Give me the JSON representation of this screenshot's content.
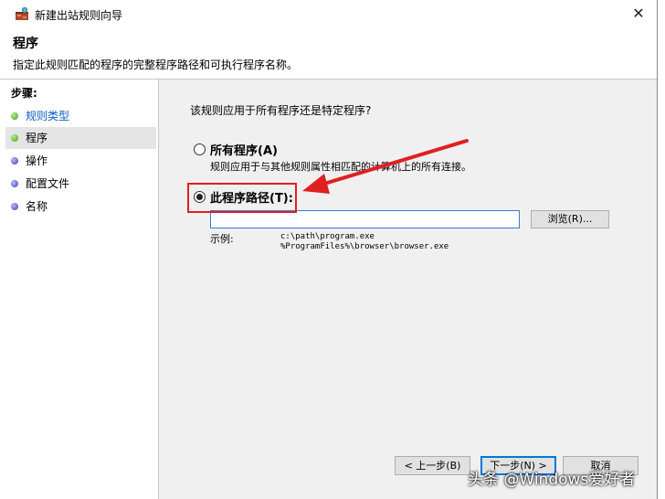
{
  "window": {
    "title": "新建出站规则向导",
    "close_glyph": "✕"
  },
  "header": {
    "page_title": "程序",
    "description": "指定此规则匹配的程序的完整程序路径和可执行程序名称。"
  },
  "sidebar": {
    "steps_heading": "步骤:",
    "items": [
      {
        "label": "规则类型",
        "dot": "green",
        "link": true
      },
      {
        "label": "程序",
        "dot": "green",
        "active": true
      },
      {
        "label": "操作",
        "dot": "blue"
      },
      {
        "label": "配置文件",
        "dot": "blue"
      },
      {
        "label": "名称",
        "dot": "blue"
      }
    ]
  },
  "main": {
    "question": "该规则应用于所有程序还是特定程序?",
    "all_programs": {
      "label": "所有程序(A)",
      "description": "规则应用于与其他规则属性相匹配的计算机上的所有连接。"
    },
    "this_program": {
      "label": "此程序路径(T):",
      "path_value": "",
      "browse_label": "浏览(R)..."
    },
    "example_label": "示例:",
    "example_lines": [
      "c:\\path\\program.exe",
      "%ProgramFiles%\\browser\\browser.exe"
    ]
  },
  "footer": {
    "back_label": "< 上一步(B)",
    "next_label": "下一步(N) >",
    "cancel_label": "取消"
  },
  "watermark": "头条 @Windows爱好者",
  "colors": {
    "highlight": "#e02020",
    "link": "#0b5ec4",
    "focus": "#0078d7"
  }
}
